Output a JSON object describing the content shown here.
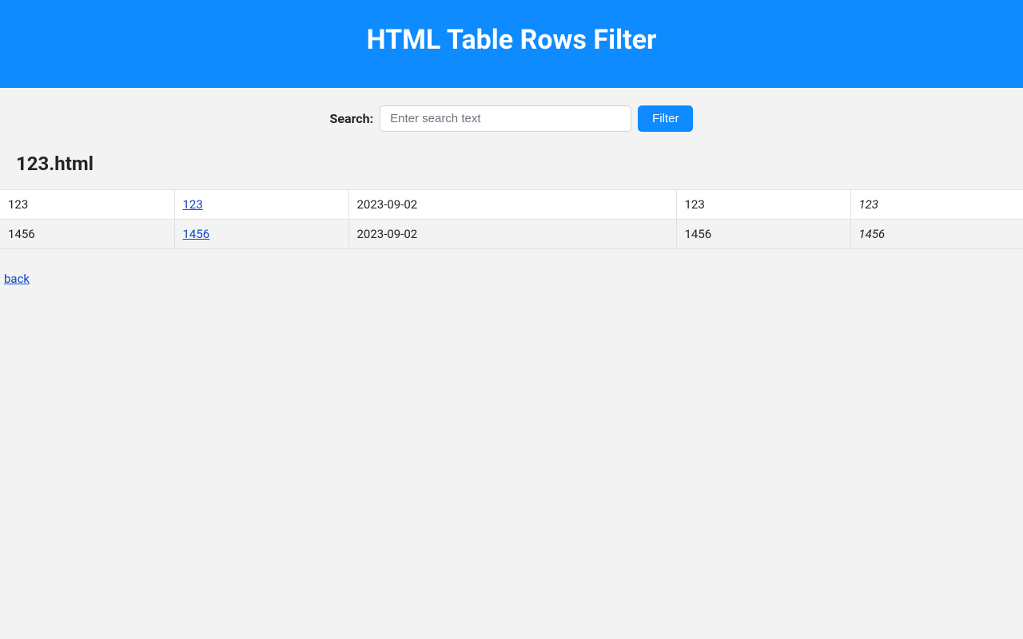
{
  "header": {
    "title": "HTML Table Rows Filter"
  },
  "search": {
    "label": "Search:",
    "placeholder": "Enter search text",
    "value": "",
    "button_label": "Filter"
  },
  "filename": "123.html",
  "table": {
    "rows": [
      {
        "c1": "123",
        "c2": "123",
        "c3": "2023-09-02",
        "c4": "123",
        "c5": "123"
      },
      {
        "c1": "1456",
        "c2": "1456",
        "c3": "2023-09-02",
        "c4": "1456",
        "c5": "1456"
      }
    ]
  },
  "back_link": "back"
}
